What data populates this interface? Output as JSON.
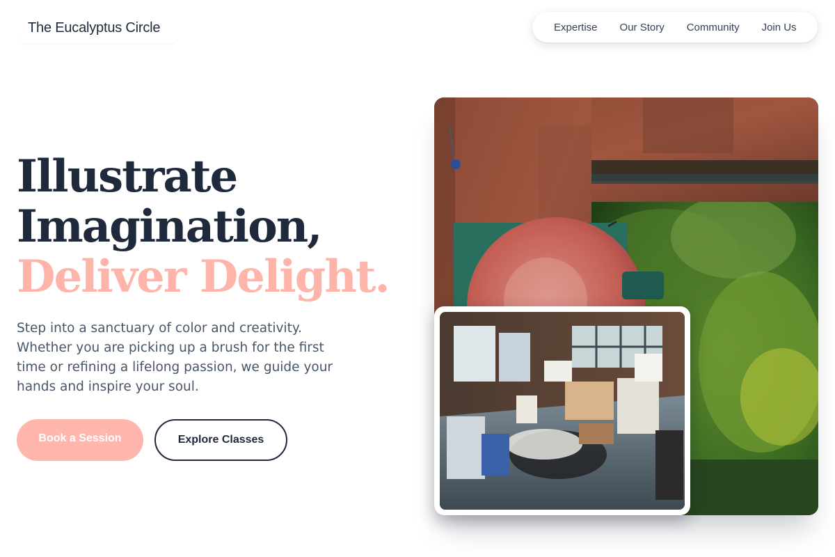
{
  "brand": {
    "name": "The Eucalyptus Circle"
  },
  "nav": {
    "items": [
      {
        "label": "Expertise"
      },
      {
        "label": "Our Story"
      },
      {
        "label": "Community"
      },
      {
        "label": "Join Us"
      }
    ]
  },
  "hero": {
    "headline_line1": "Illustrate",
    "headline_line2": "Imagination,",
    "headline_accent": "Deliver Delight.",
    "description": "Step into a sanctuary of color and creativity. Whether you are picking up a brush for the first time or refining a lifelong passion, we guide your hands and inspire your soul.",
    "primary_cta": "Book a Session",
    "secondary_cta": "Explore Classes"
  },
  "colors": {
    "ink": "#1e293b",
    "accent": "#ffb4aa",
    "body_text": "#475569"
  }
}
